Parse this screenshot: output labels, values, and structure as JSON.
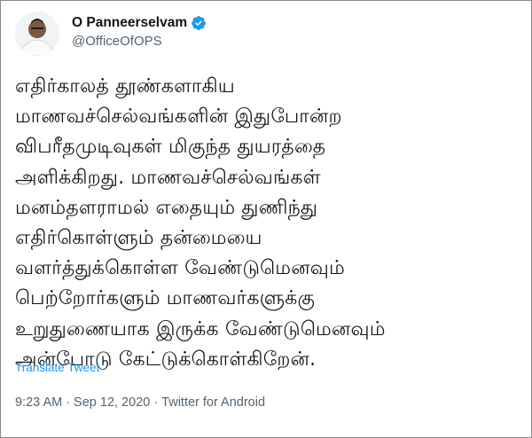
{
  "author": {
    "display_name": "O Panneerselvam",
    "handle": "@OfficeOfOPS",
    "verified_icon": "verified-badge-icon",
    "avatar_icon": "profile-avatar-icon"
  },
  "tweet": {
    "lines": [
      "எதிர்காலத் தூண்களாகிய",
      "மாணவச்செல்வங்களின் இதுபோன்ற",
      "விபரீதமுடிவுகள் மிகுந்த துயரத்தை",
      "அளிக்கிறது. மாணவச்செல்வங்கள்",
      "மனம்தளராமல் எதையும் துணிந்து",
      "எதிர்கொள்ளும் தன்மையை",
      "வளர்த்துக்கொள்ள வேண்டுமெனவும்",
      "பெற்றோர்களும் மாணவர்களுக்கு",
      "உறுதுணையாக இருக்க வேண்டுமெனவும்",
      "அன்போடு கேட்டுக்கொள்கிறேன்."
    ],
    "translate_label": "Translate Tweet"
  },
  "meta": {
    "time": "9:23 AM",
    "separator1": "·",
    "date": "Sep 12, 2020",
    "separator2": "·",
    "source": "Twitter for Android"
  },
  "colors": {
    "link": "#1d9bf0",
    "secondary_text": "#536471",
    "primary_text": "#0f1419",
    "verified": "#1d9bf0"
  }
}
